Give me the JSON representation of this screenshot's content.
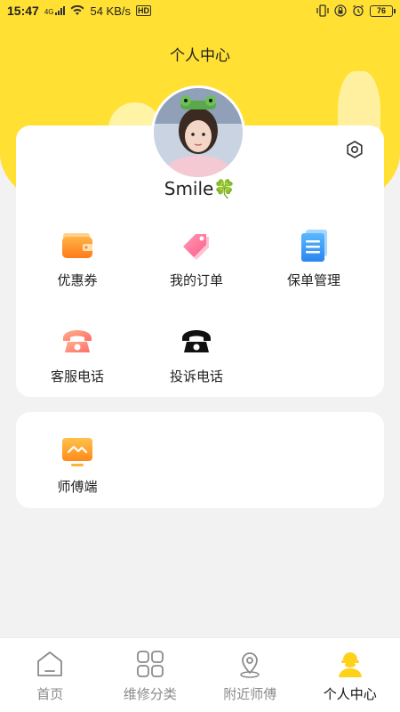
{
  "status_bar": {
    "time": "15:47",
    "network_label": "4G",
    "speed": "54 KB/s",
    "hd_label": "HD",
    "battery": "76"
  },
  "header": {
    "title": "个人中心"
  },
  "profile": {
    "username": "Smile🍀"
  },
  "main_menu": [
    {
      "label": "优惠券",
      "icon": "wallet-icon"
    },
    {
      "label": "我的订单",
      "icon": "tag-icon"
    },
    {
      "label": "保单管理",
      "icon": "document-icon"
    },
    {
      "label": "客服电话",
      "icon": "telephone-icon"
    },
    {
      "label": "投诉电话",
      "icon": "telephone-black-icon"
    }
  ],
  "extra_menu": [
    {
      "label": "师傅端",
      "icon": "monitor-icon"
    }
  ],
  "bottom_nav": {
    "items": [
      {
        "label": "首页",
        "icon": "home-icon"
      },
      {
        "label": "维修分类",
        "icon": "grid-icon"
      },
      {
        "label": "附近师傅",
        "icon": "location-icon"
      },
      {
        "label": "个人中心",
        "icon": "profile-icon"
      }
    ],
    "active": "个人中心"
  },
  "colors": {
    "brand_yellow": "#ffe033",
    "nav_inactive": "#8a8a8a"
  }
}
